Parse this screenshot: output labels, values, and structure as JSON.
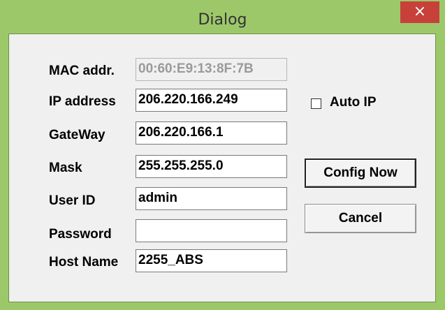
{
  "window": {
    "title": "Dialog",
    "close_glyph": "×",
    "frame_color": "#9dc86a",
    "close_color": "#c7413a"
  },
  "form": {
    "mac": {
      "label": "MAC addr.",
      "value": "00:60:E9:13:8F:7B"
    },
    "ip": {
      "label": "IP address",
      "value": "206.220.166.249"
    },
    "gateway": {
      "label": "GateWay",
      "value": "206.220.166.1"
    },
    "mask": {
      "label": "Mask",
      "value": "255.255.255.0"
    },
    "user_id": {
      "label": "User ID",
      "value": "admin"
    },
    "password": {
      "label": "Password",
      "value": ""
    },
    "host_name": {
      "label": "Host Name",
      "value": "2255_ABS"
    }
  },
  "auto_ip": {
    "label": "Auto IP",
    "checked": false
  },
  "buttons": {
    "config_now": "Config Now",
    "cancel": "Cancel"
  }
}
